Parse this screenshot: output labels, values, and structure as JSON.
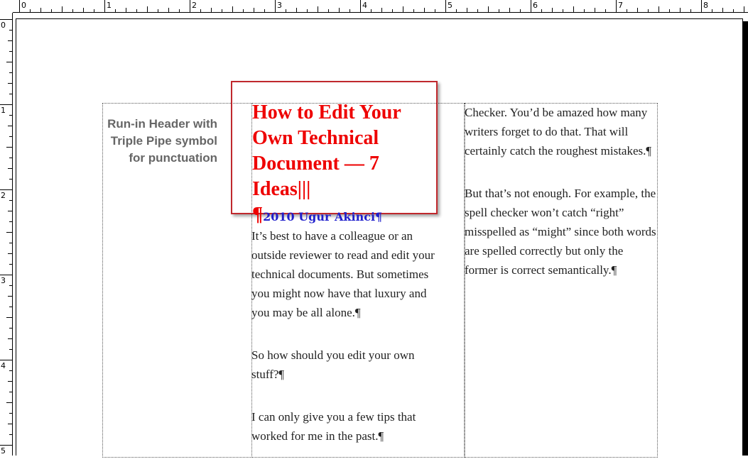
{
  "ruler": {
    "horizontal_labels": [
      "0",
      "1",
      "2",
      "3",
      "4",
      "5",
      "6",
      "7",
      "8"
    ],
    "vertical_labels": [
      "0",
      "1",
      "2",
      "3",
      "4",
      "5"
    ]
  },
  "sidebar": {
    "heading": "Run-in Header with Triple Pipe symbol for punctuation"
  },
  "title_box": {
    "title": "How to Edit Your Own Technical Document — 7 Ideas|||¶",
    "byline": "2010 Ugur Akinci¶",
    "title_color": "#ee0000",
    "byline_color": "#1f1fcc",
    "border_color": "#c0282d"
  },
  "column1": {
    "paragraphs": [
      "It’s best to have a colleague or an outside reviewer to read and edit your technical documents. But sometimes you might now have that luxury and you may be all alone.¶",
      "So how should you edit your own stuff?¶",
      "I can only give you a few tips that worked for me in the past.¶"
    ]
  },
  "column2": {
    "paragraphs": [
      "Checker. You’d be amazed how many writers forget to do that. That will certainly catch the roughest mistakes.¶",
      "But that’s not enough. For example, the spell checker won’t catch “right” misspelled as “might” since both words are spelled correctly but only the former is correct semantically.¶"
    ]
  }
}
